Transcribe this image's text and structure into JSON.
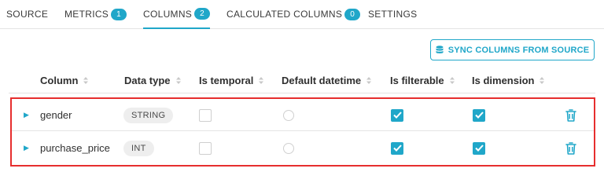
{
  "tabs": [
    {
      "label": "SOURCE",
      "badge": null,
      "active": false
    },
    {
      "label": "METRICS",
      "badge": "1",
      "active": false
    },
    {
      "label": "COLUMNS",
      "badge": "2",
      "active": true
    },
    {
      "label": "CALCULATED COLUMNS",
      "badge": "0",
      "active": false
    },
    {
      "label": "SETTINGS",
      "badge": null,
      "active": false
    }
  ],
  "sync_button": {
    "label": "SYNC COLUMNS FROM SOURCE",
    "icon": "database-icon"
  },
  "table": {
    "headers": [
      "Column",
      "Data type",
      "Is temporal",
      "Default datetime",
      "Is filterable",
      "Is dimension"
    ],
    "rows": [
      {
        "column": "gender",
        "data_type": "STRING",
        "is_temporal": false,
        "default_datetime": false,
        "is_filterable": true,
        "is_dimension": true
      },
      {
        "column": "purchase_price",
        "data_type": "INT",
        "is_temporal": false,
        "default_datetime": false,
        "is_filterable": true,
        "is_dimension": true
      }
    ]
  },
  "colors": {
    "accent": "#20a7c9",
    "highlight_border": "#e62e2e"
  }
}
